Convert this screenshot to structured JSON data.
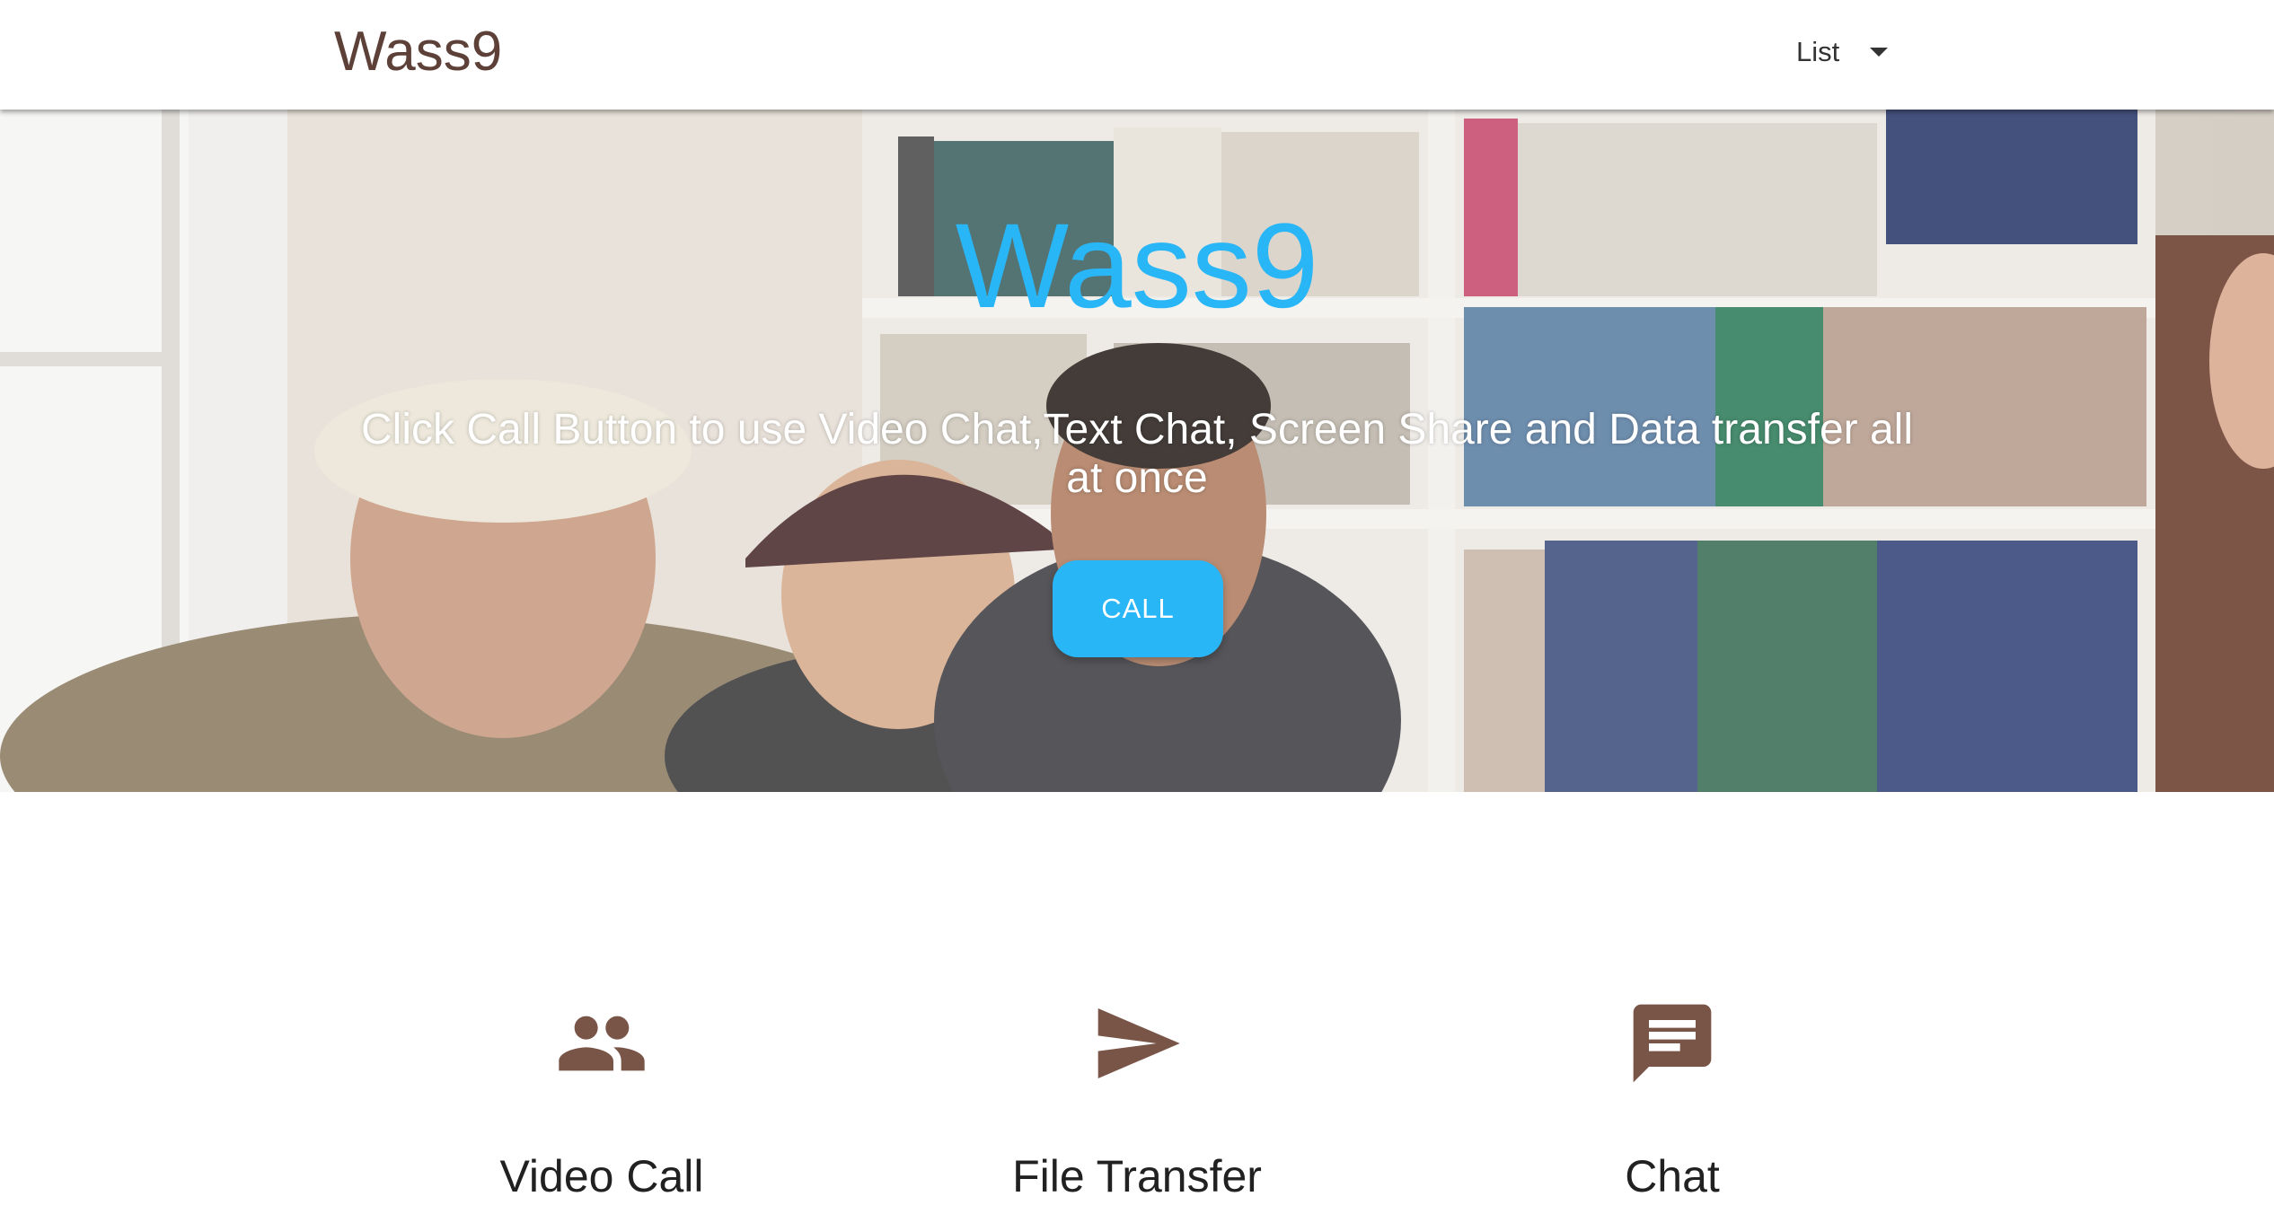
{
  "navbar": {
    "brand": "Wass9",
    "dropdown_label": "List",
    "dropdown_icon": "caret-down-icon"
  },
  "hero": {
    "title": "Wass9",
    "subtitle": "Click Call Button to use Video Chat,Text Chat, Screen Share and Data transfer all at once",
    "call_label": "CALL"
  },
  "features": [
    {
      "icon": "people-icon",
      "title": "Video Call"
    },
    {
      "icon": "send-icon",
      "title": "File Transfer"
    },
    {
      "icon": "chat-icon",
      "title": "Chat"
    }
  ],
  "colors": {
    "brand": "#5d4037",
    "accent": "#29b6f6",
    "icon": "#795548"
  }
}
